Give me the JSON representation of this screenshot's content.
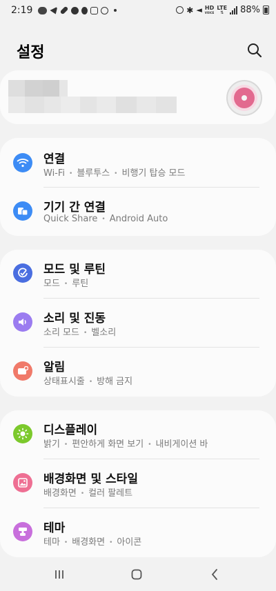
{
  "status_bar": {
    "time": "2:19",
    "network_hd": "HD",
    "network_voice": "VOICE",
    "network_lte": "LTE",
    "battery": "88%"
  },
  "header": {
    "title": "설정",
    "search_icon": "search-icon"
  },
  "profile": {
    "avatar_icon": "donut-avatar"
  },
  "sections": [
    {
      "items": [
        {
          "id": "connections",
          "title": "연결",
          "subs": [
            "Wi-Fi",
            "블루투스",
            "비행기 탑승 모드"
          ],
          "icon": "wifi-icon",
          "color": "#3d8cf5"
        },
        {
          "id": "connected-devices",
          "title": "기기 간 연결",
          "subs": [
            "Quick Share",
            "Android Auto"
          ],
          "icon": "devices-icon",
          "color": "#3d8cf5"
        }
      ]
    },
    {
      "items": [
        {
          "id": "modes-routines",
          "title": "모드 및 루틴",
          "subs": [
            "모드",
            "루틴"
          ],
          "icon": "check-circle-icon",
          "color": "#4a6ee0"
        },
        {
          "id": "sounds-vibration",
          "title": "소리 및 진동",
          "subs": [
            "소리 모드",
            "벨소리"
          ],
          "icon": "volume-icon",
          "color": "#9b7cf0"
        },
        {
          "id": "notifications",
          "title": "알림",
          "subs": [
            "상태표시줄",
            "방해 금지"
          ],
          "icon": "notification-icon",
          "color": "#f07a6a"
        }
      ]
    },
    {
      "items": [
        {
          "id": "display",
          "title": "디스플레이",
          "subs": [
            "밝기",
            "편안하게 화면 보기",
            "내비게이션 바"
          ],
          "icon": "brightness-icon",
          "color": "#7cc92c"
        },
        {
          "id": "wallpaper-style",
          "title": "배경화면 및 스타일",
          "subs": [
            "배경화면",
            "컬러 팔레트"
          ],
          "icon": "image-icon",
          "color": "#ee6f93"
        },
        {
          "id": "themes",
          "title": "테마",
          "subs": [
            "테마",
            "배경화면",
            "아이콘"
          ],
          "icon": "themes-icon",
          "color": "#c86fdc"
        }
      ]
    }
  ],
  "nav_bar": {
    "recents": "recents-icon",
    "home": "home-icon",
    "back": "back-icon"
  }
}
